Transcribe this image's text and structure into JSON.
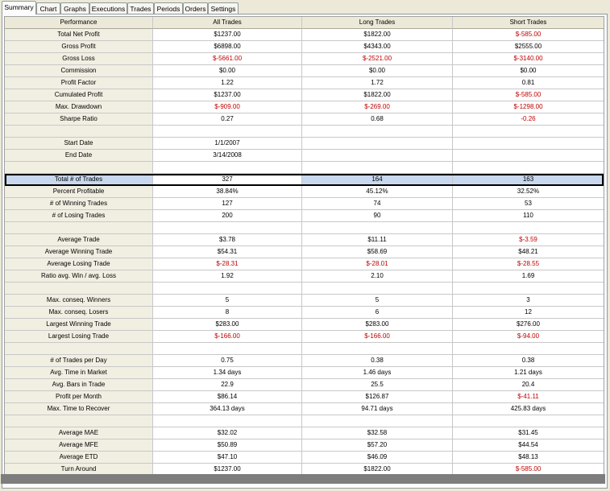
{
  "tabs": [
    {
      "label": "Summary",
      "active": true
    },
    {
      "label": "Chart",
      "active": false
    },
    {
      "label": "Graphs",
      "active": false
    },
    {
      "label": "Executions",
      "active": false
    },
    {
      "label": "Trades",
      "active": false
    },
    {
      "label": "Periods",
      "active": false
    },
    {
      "label": "Orders",
      "active": false
    },
    {
      "label": "Settings",
      "active": false
    }
  ],
  "table": {
    "columns": [
      "Performance",
      "All Trades",
      "Long Trades",
      "Short Trades"
    ],
    "selected_label": "Total # of Trades",
    "rows": [
      {
        "label": "Total Net Profit",
        "all": "$1237.00",
        "long": "$1822.00",
        "short": "$-585.00"
      },
      {
        "label": "Gross Profit",
        "all": "$6898.00",
        "long": "$4343.00",
        "short": "$2555.00"
      },
      {
        "label": "Gross Loss",
        "all": "$-5661.00",
        "long": "$-2521.00",
        "short": "$-3140.00"
      },
      {
        "label": "Commission",
        "all": "$0.00",
        "long": "$0.00",
        "short": "$0.00"
      },
      {
        "label": "Profit Factor",
        "all": "1.22",
        "long": "1.72",
        "short": "0.81"
      },
      {
        "label": "Cumulated Profit",
        "all": "$1237.00",
        "long": "$1822.00",
        "short": "$-585.00"
      },
      {
        "label": "Max. Drawdown",
        "all": "$-909.00",
        "long": "$-269.00",
        "short": "$-1298.00"
      },
      {
        "label": "Sharpe Ratio",
        "all": "0.27",
        "long": "0.68",
        "short": "-0.26"
      },
      {
        "label": "",
        "all": "",
        "long": "",
        "short": ""
      },
      {
        "label": "Start Date",
        "all": "1/1/2007",
        "long": "",
        "short": ""
      },
      {
        "label": "End Date",
        "all": "3/14/2008",
        "long": "",
        "short": ""
      },
      {
        "label": "",
        "all": "",
        "long": "",
        "short": ""
      },
      {
        "label": "Total # of Trades",
        "all": "327",
        "long": "164",
        "short": "163"
      },
      {
        "label": "Percent Profitable",
        "all": "38.84%",
        "long": "45.12%",
        "short": "32.52%"
      },
      {
        "label": "# of Winning Trades",
        "all": "127",
        "long": "74",
        "short": "53"
      },
      {
        "label": "# of Losing Trades",
        "all": "200",
        "long": "90",
        "short": "110"
      },
      {
        "label": "",
        "all": "",
        "long": "",
        "short": ""
      },
      {
        "label": "Average Trade",
        "all": "$3.78",
        "long": "$11.11",
        "short": "$-3.59"
      },
      {
        "label": "Average Winning Trade",
        "all": "$54.31",
        "long": "$58.69",
        "short": "$48.21"
      },
      {
        "label": "Average Losing Trade",
        "all": "$-28.31",
        "long": "$-28.01",
        "short": "$-28.55"
      },
      {
        "label": "Ratio avg. Win / avg. Loss",
        "all": "1.92",
        "long": "2.10",
        "short": "1.69"
      },
      {
        "label": "",
        "all": "",
        "long": "",
        "short": ""
      },
      {
        "label": "Max. conseq. Winners",
        "all": "5",
        "long": "5",
        "short": "3"
      },
      {
        "label": "Max. conseq. Losers",
        "all": "8",
        "long": "6",
        "short": "12"
      },
      {
        "label": "Largest Winning Trade",
        "all": "$283.00",
        "long": "$283.00",
        "short": "$276.00"
      },
      {
        "label": "Largest Losing Trade",
        "all": "$-166.00",
        "long": "$-166.00",
        "short": "$-94.00"
      },
      {
        "label": "",
        "all": "",
        "long": "",
        "short": ""
      },
      {
        "label": "# of Trades per Day",
        "all": "0.75",
        "long": "0.38",
        "short": "0.38"
      },
      {
        "label": "Avg. Time in Market",
        "all": "1.34 days",
        "long": "1.46 days",
        "short": "1.21 days"
      },
      {
        "label": "Avg. Bars in Trade",
        "all": "22.9",
        "long": "25.5",
        "short": "20.4"
      },
      {
        "label": "Profit per Month",
        "all": "$86.14",
        "long": "$126.87",
        "short": "$-41.11"
      },
      {
        "label": "Max. Time to Recover",
        "all": "364.13 days",
        "long": "94.71 days",
        "short": "425.83 days"
      },
      {
        "label": "",
        "all": "",
        "long": "",
        "short": ""
      },
      {
        "label": "Average MAE",
        "all": "$32.02",
        "long": "$32.58",
        "short": "$31.45"
      },
      {
        "label": "Average MFE",
        "all": "$50.89",
        "long": "$57.20",
        "short": "$44.54"
      },
      {
        "label": "Average ETD",
        "all": "$47.10",
        "long": "$46.09",
        "short": "$48.13"
      },
      {
        "label": "Turn Around",
        "all": "$1237.00",
        "long": "$1822.00",
        "short": "$-585.00"
      }
    ]
  },
  "colors": {
    "negative": "#c00000",
    "selected_row": "#c9d8ee"
  }
}
